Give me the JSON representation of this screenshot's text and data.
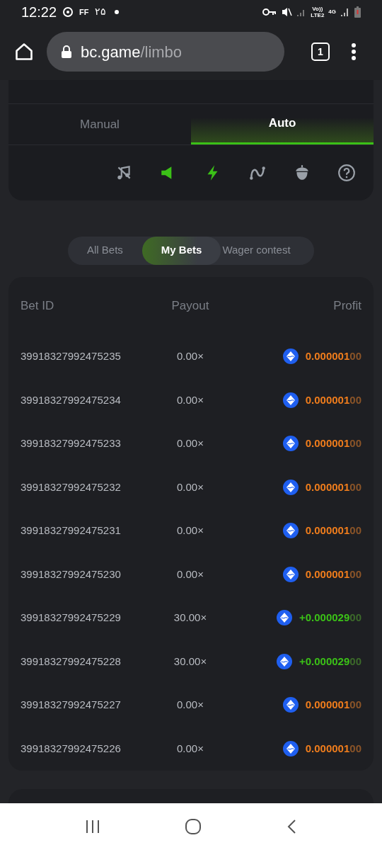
{
  "status_bar": {
    "time": "12:22",
    "app_label": "FF",
    "date": "۲۵",
    "network_label": "Vo))\nLTE2",
    "data_label": "4G"
  },
  "browser": {
    "domain": "bc.game",
    "path": "/limbo",
    "tab_count": "1"
  },
  "mode_tabs": [
    {
      "label": "Manual",
      "selected": false
    },
    {
      "label": "Auto",
      "selected": true
    }
  ],
  "tools": [
    {
      "kind": "music",
      "on": false
    },
    {
      "kind": "sound",
      "on": true
    },
    {
      "kind": "bolt",
      "on": true
    },
    {
      "kind": "curve",
      "on": false
    },
    {
      "kind": "acorn",
      "on": false
    },
    {
      "kind": "help",
      "on": false
    }
  ],
  "bet_tabs": [
    {
      "label": "All Bets",
      "selected": false
    },
    {
      "label": "My Bets",
      "selected": true
    },
    {
      "label": "Wager contest",
      "selected": false
    }
  ],
  "table": {
    "columns": [
      "Bet ID",
      "Payout",
      "Profit"
    ],
    "rows": [
      {
        "id": "39918327992475235",
        "payout": "0.00×",
        "profit": "0.000001",
        "profit_tail": "00",
        "kind": "loss"
      },
      {
        "id": "39918327992475234",
        "payout": "0.00×",
        "profit": "0.000001",
        "profit_tail": "00",
        "kind": "loss"
      },
      {
        "id": "39918327992475233",
        "payout": "0.00×",
        "profit": "0.000001",
        "profit_tail": "00",
        "kind": "loss"
      },
      {
        "id": "39918327992475232",
        "payout": "0.00×",
        "profit": "0.000001",
        "profit_tail": "00",
        "kind": "loss"
      },
      {
        "id": "39918327992475231",
        "payout": "0.00×",
        "profit": "0.000001",
        "profit_tail": "00",
        "kind": "loss"
      },
      {
        "id": "39918327992475230",
        "payout": "0.00×",
        "profit": "0.000001",
        "profit_tail": "00",
        "kind": "loss"
      },
      {
        "id": "39918327992475229",
        "payout": "30.00×",
        "profit": "+0.000029",
        "profit_tail": "00",
        "kind": "win"
      },
      {
        "id": "39918327992475228",
        "payout": "30.00×",
        "profit": "+0.000029",
        "profit_tail": "00",
        "kind": "win"
      },
      {
        "id": "39918327992475227",
        "payout": "0.00×",
        "profit": "0.000001",
        "profit_tail": "00",
        "kind": "loss"
      },
      {
        "id": "39918327992475226",
        "payout": "0.00×",
        "profit": "0.000001",
        "profit_tail": "00",
        "kind": "loss"
      }
    ]
  }
}
